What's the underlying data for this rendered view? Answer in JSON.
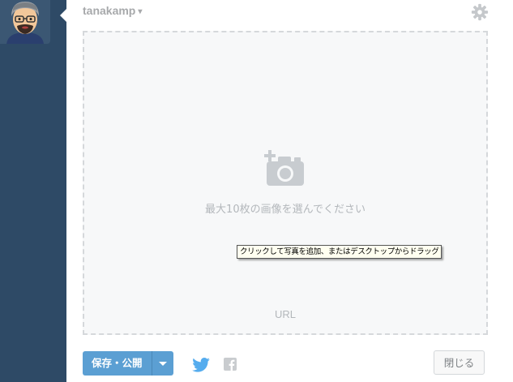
{
  "header": {
    "username": "tanakamp",
    "username_caret": "▾",
    "settings_icon": "gear-icon"
  },
  "dropzone": {
    "hint": "最大10枚の画像を選んでください",
    "url_label": "URL",
    "camera_icon": "camera-plus-icon"
  },
  "tooltip": {
    "text": "クリックして写真を追加、またはデスクトップからドラッグ"
  },
  "footer": {
    "publish_label": "保存・公開",
    "close_label": "閉じる",
    "share_icons": [
      "twitter-icon",
      "facebook-icon"
    ]
  },
  "colors": {
    "sidebar": "#2e4a66",
    "primary_button": "#5b9fd3",
    "twitter": "#55acee",
    "muted_text": "#a7a9ab"
  }
}
